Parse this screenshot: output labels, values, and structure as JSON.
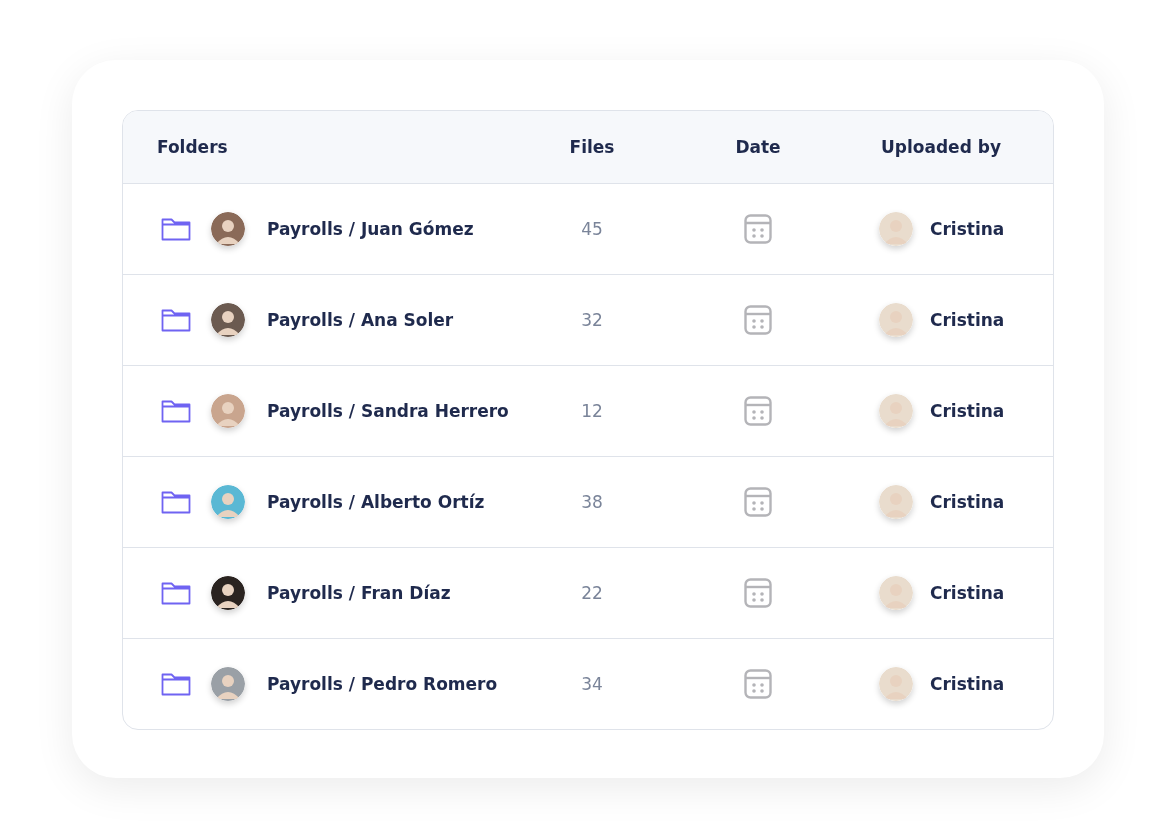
{
  "table": {
    "columns": [
      "Folders",
      "Files",
      "Date",
      "Uploaded by"
    ],
    "rows": [
      {
        "folder": "Payrolls / Juan Gómez",
        "files": "45",
        "uploaded_by": "Cristina"
      },
      {
        "folder": "Payrolls / Ana Soler",
        "files": "32",
        "uploaded_by": "Cristina"
      },
      {
        "folder": "Payrolls / Sandra Herrero",
        "files": "12",
        "uploaded_by": "Cristina"
      },
      {
        "folder": "Payrolls / Alberto Ortíz",
        "files": "38",
        "uploaded_by": "Cristina"
      },
      {
        "folder": "Payrolls / Fran Díaz",
        "files": "22",
        "uploaded_by": "Cristina"
      },
      {
        "folder": "Payrolls / Pedro Romero",
        "files": "34",
        "uploaded_by": "Cristina"
      }
    ]
  }
}
